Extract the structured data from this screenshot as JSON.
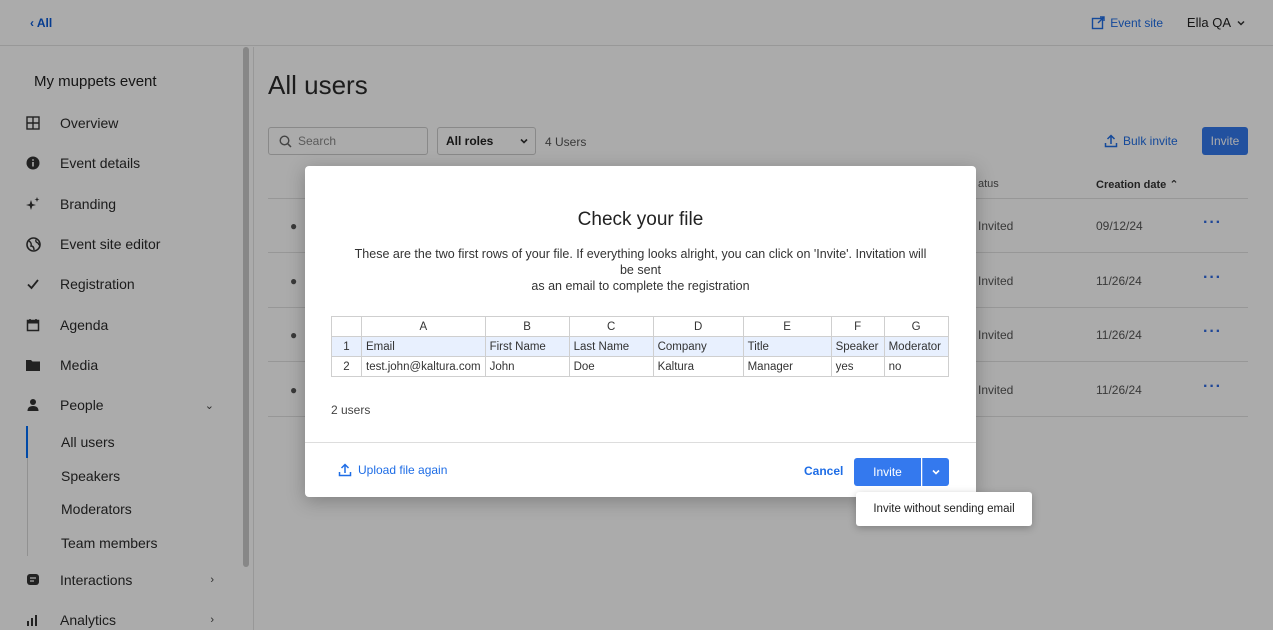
{
  "topbar": {
    "back_label": "‹ All",
    "event_site_label": "Event site",
    "user_name": "Ella QA"
  },
  "sidebar": {
    "event_name": "My muppets event",
    "items": [
      {
        "label": "Overview",
        "icon": "grid-icon"
      },
      {
        "label": "Event details",
        "icon": "info-icon"
      },
      {
        "label": "Branding",
        "icon": "sparkle-icon"
      },
      {
        "label": "Event site editor",
        "icon": "globe-icon"
      },
      {
        "label": "Registration",
        "icon": "check-icon"
      },
      {
        "label": "Agenda",
        "icon": "calendar-icon"
      },
      {
        "label": "Media",
        "icon": "folder-icon"
      },
      {
        "label": "People",
        "icon": "person-icon"
      }
    ],
    "people_sub": [
      "All users",
      "Speakers",
      "Moderators",
      "Team members"
    ],
    "bottom_items": [
      {
        "label": "Interactions",
        "icon": "chat-icon"
      },
      {
        "label": "Analytics",
        "icon": "bar-chart-icon"
      }
    ]
  },
  "main": {
    "title": "All users",
    "search_placeholder": "Search",
    "roles_filter": "All roles",
    "users_count": "4 Users",
    "bulk_invite_label": "Bulk invite",
    "invite_label": "Invite",
    "columns": {
      "status": "atus",
      "creation_date": "Creation date"
    },
    "rows": [
      {
        "status": "Invited",
        "date": "09/12/24"
      },
      {
        "status": "Invited",
        "date": "11/26/24"
      },
      {
        "status": "Invited",
        "date": "11/26/24"
      },
      {
        "status": "Invited",
        "date": "11/26/24"
      }
    ]
  },
  "modal": {
    "title": "Check your file",
    "desc_line1": "These are the two first rows of your file. If everything looks alright, you can click on 'Invite'. Invitation will",
    "desc_line2": "be sent",
    "desc_line3": "as an email to complete the registration",
    "sheet": {
      "columns": [
        "A",
        "B",
        "C",
        "D",
        "E",
        "F",
        "G"
      ],
      "rows": [
        {
          "num": "1",
          "cells": [
            "Email",
            "First Name",
            "Last Name",
            "Company",
            "Title",
            "Speaker",
            "Moderator"
          ]
        },
        {
          "num": "2",
          "cells": [
            "test.john@kaltura.com",
            "John",
            "Doe",
            "Kaltura",
            "Manager",
            "yes",
            "no"
          ]
        }
      ]
    },
    "users_count": "2 users",
    "upload_again_label": "Upload file again",
    "cancel_label": "Cancel",
    "invite_label": "Invite",
    "dropdown_option": "Invite without sending email"
  }
}
